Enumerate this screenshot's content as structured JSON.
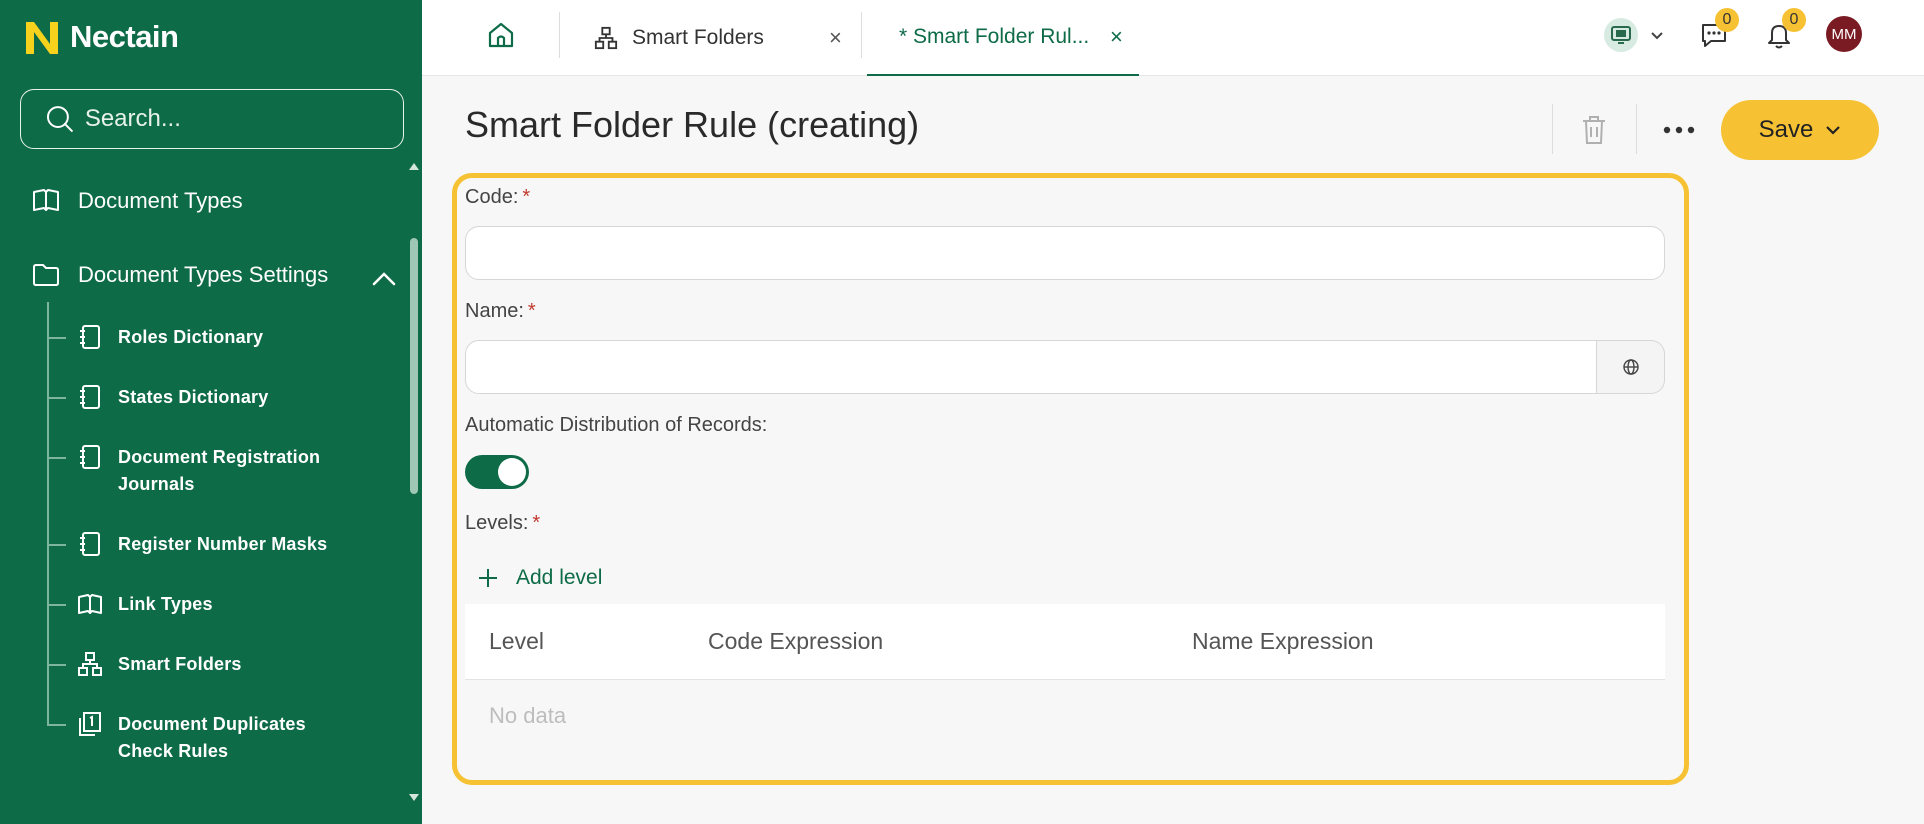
{
  "app": {
    "name": "Nectain"
  },
  "colors": {
    "brand_green": "#0e6b47",
    "accent_yellow": "#f6c233",
    "avatar_bg": "#7a1b23"
  },
  "search": {
    "placeholder": "Search..."
  },
  "sidebar": {
    "items": [
      {
        "label": "Document Types",
        "icon": "book-open-icon"
      },
      {
        "label": "Document Types Settings",
        "icon": "folder-icon",
        "expanded": true
      }
    ],
    "sub_items": [
      {
        "lines": [
          "Roles Dictionary"
        ],
        "icon": "notebook-icon"
      },
      {
        "lines": [
          "States Dictionary"
        ],
        "icon": "notebook-icon"
      },
      {
        "lines": [
          "Document Registration",
          "Journals"
        ],
        "icon": "notebook-icon"
      },
      {
        "lines": [
          "Register Number Masks"
        ],
        "icon": "notebook-icon"
      },
      {
        "lines": [
          "Link Types"
        ],
        "icon": "book-open-icon"
      },
      {
        "lines": [
          "Smart Folders"
        ],
        "icon": "sitemap-icon"
      },
      {
        "lines": [
          "Document Duplicates",
          "Check Rules"
        ],
        "icon": "duplicate-one-icon"
      }
    ]
  },
  "tabs": [
    {
      "label": "Smart Folders",
      "icon": "sitemap-icon",
      "active": false
    },
    {
      "label": "* Smart Folder Rul...",
      "active": true
    }
  ],
  "header": {
    "chat_count": "0",
    "notification_count": "0",
    "avatar_initials": "MM"
  },
  "page": {
    "title": "Smart Folder Rule (creating)",
    "save_label": "Save"
  },
  "form": {
    "code_label": "Code:",
    "name_label": "Name:",
    "auto_distribution_label": "Automatic Distribution of Records:",
    "auto_distribution_on": true,
    "levels_label": "Levels:",
    "add_level_label": "Add level",
    "required_mark": "*",
    "table": {
      "columns": [
        "Level",
        "Code Expression",
        "Name Expression"
      ],
      "empty_text": "No data"
    }
  }
}
